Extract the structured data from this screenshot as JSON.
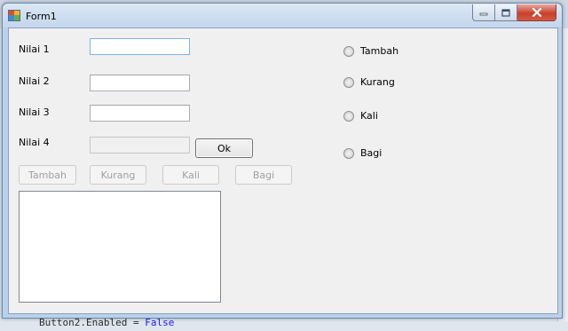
{
  "window": {
    "title": "Form1",
    "icon": "winforms-app-icon"
  },
  "fields": [
    {
      "label": "Nilai 1",
      "value": "",
      "enabled": true
    },
    {
      "label": "Nilai 2",
      "value": "",
      "enabled": true
    },
    {
      "label": "Nilai 3",
      "value": "",
      "enabled": true
    },
    {
      "label": "Nilai 4",
      "value": "",
      "enabled": false
    }
  ],
  "ok_button": "Ok",
  "operation_buttons": [
    {
      "label": "Tambah",
      "enabled": false
    },
    {
      "label": "Kurang",
      "enabled": false
    },
    {
      "label": "Kali",
      "enabled": false
    },
    {
      "label": "Bagi",
      "enabled": false
    }
  ],
  "radio_options": [
    {
      "label": "Tambah",
      "checked": false
    },
    {
      "label": "Kurang",
      "checked": false
    },
    {
      "label": "Kali",
      "checked": false
    },
    {
      "label": "Bagi",
      "checked": false
    }
  ],
  "background_code": {
    "text": "Button2.Enabled = ",
    "keyword": "False"
  },
  "colors": {
    "close_button": "#c8402c",
    "form_background": "#f0f0f0",
    "titlebar": "#c3d6ec"
  }
}
